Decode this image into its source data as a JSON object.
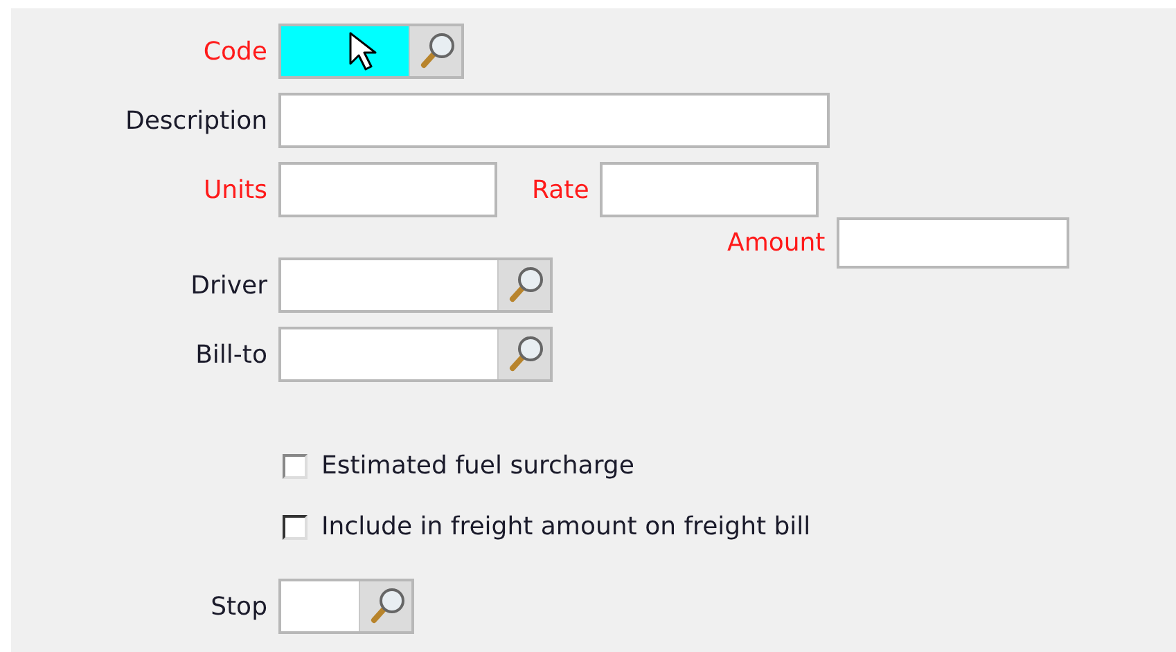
{
  "fields": [
    {
      "kind": "lookup",
      "label": "Code",
      "required": true,
      "focused": true
    },
    {
      "kind": "text",
      "label": "Description",
      "required": false,
      "focused": false
    }
  ],
  "units": {
    "label": "Units",
    "required": true
  },
  "rate": {
    "label": "Rate",
    "required": true
  },
  "amount": {
    "label": "Amount",
    "required": true
  },
  "driver": {
    "label": "Driver",
    "required": false
  },
  "bill_to": {
    "label": "Bill-to",
    "required": false
  },
  "checkboxes": [
    {
      "label": "Estimated fuel surcharge",
      "checked": false
    },
    {
      "label": "Include in freight amount on freight bill",
      "checked": false
    }
  ],
  "stop": {
    "label": "Stop",
    "required": false
  }
}
